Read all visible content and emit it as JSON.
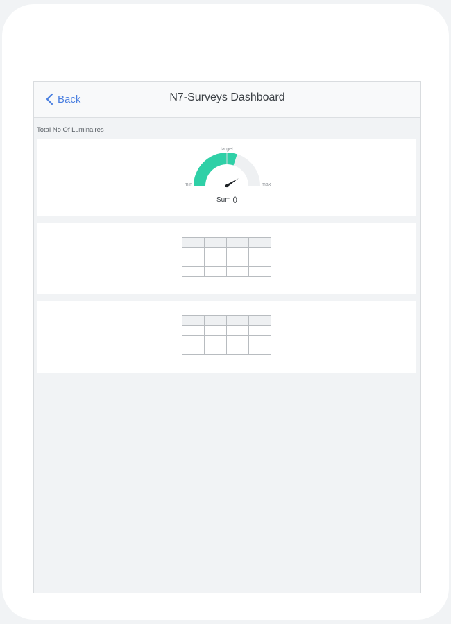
{
  "nav": {
    "back_label": "Back",
    "title": "N7-Surveys Dashboard"
  },
  "section": {
    "label": "Total No Of Luminaires"
  },
  "gauge": {
    "target_label": "target",
    "min_label": "min",
    "max_label": "max",
    "caption": "Sum ()",
    "fill_fraction": 0.6,
    "needle_fraction": 0.82,
    "fill_color": "#2fd0a7",
    "track_color": "#eef0f2"
  },
  "tables": [
    {
      "rows": 4,
      "cols": 4
    },
    {
      "rows": 4,
      "cols": 4
    }
  ],
  "colors": {
    "accent": "#4a7fe0",
    "background": "#f1f3f5"
  }
}
